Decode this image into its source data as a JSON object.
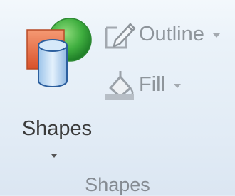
{
  "ribbon_group": {
    "label": "Shapes",
    "shapes_button": {
      "label": "Shapes",
      "icon": "shapes-icon",
      "has_dropdown": true
    },
    "outline_button": {
      "label": "Outline",
      "icon": "outline-icon",
      "enabled": false,
      "has_dropdown": true
    },
    "fill_button": {
      "label": "Fill",
      "icon": "fill-icon",
      "enabled": false,
      "has_dropdown": true
    }
  },
  "colors": {
    "background": "#e4eef7",
    "text": "#3b3b3b",
    "disabled_text": "#8e959b",
    "shape_orange": "#e8653a",
    "shape_green": "#3aa53f",
    "cylinder_blue": "#a9cdf0"
  }
}
